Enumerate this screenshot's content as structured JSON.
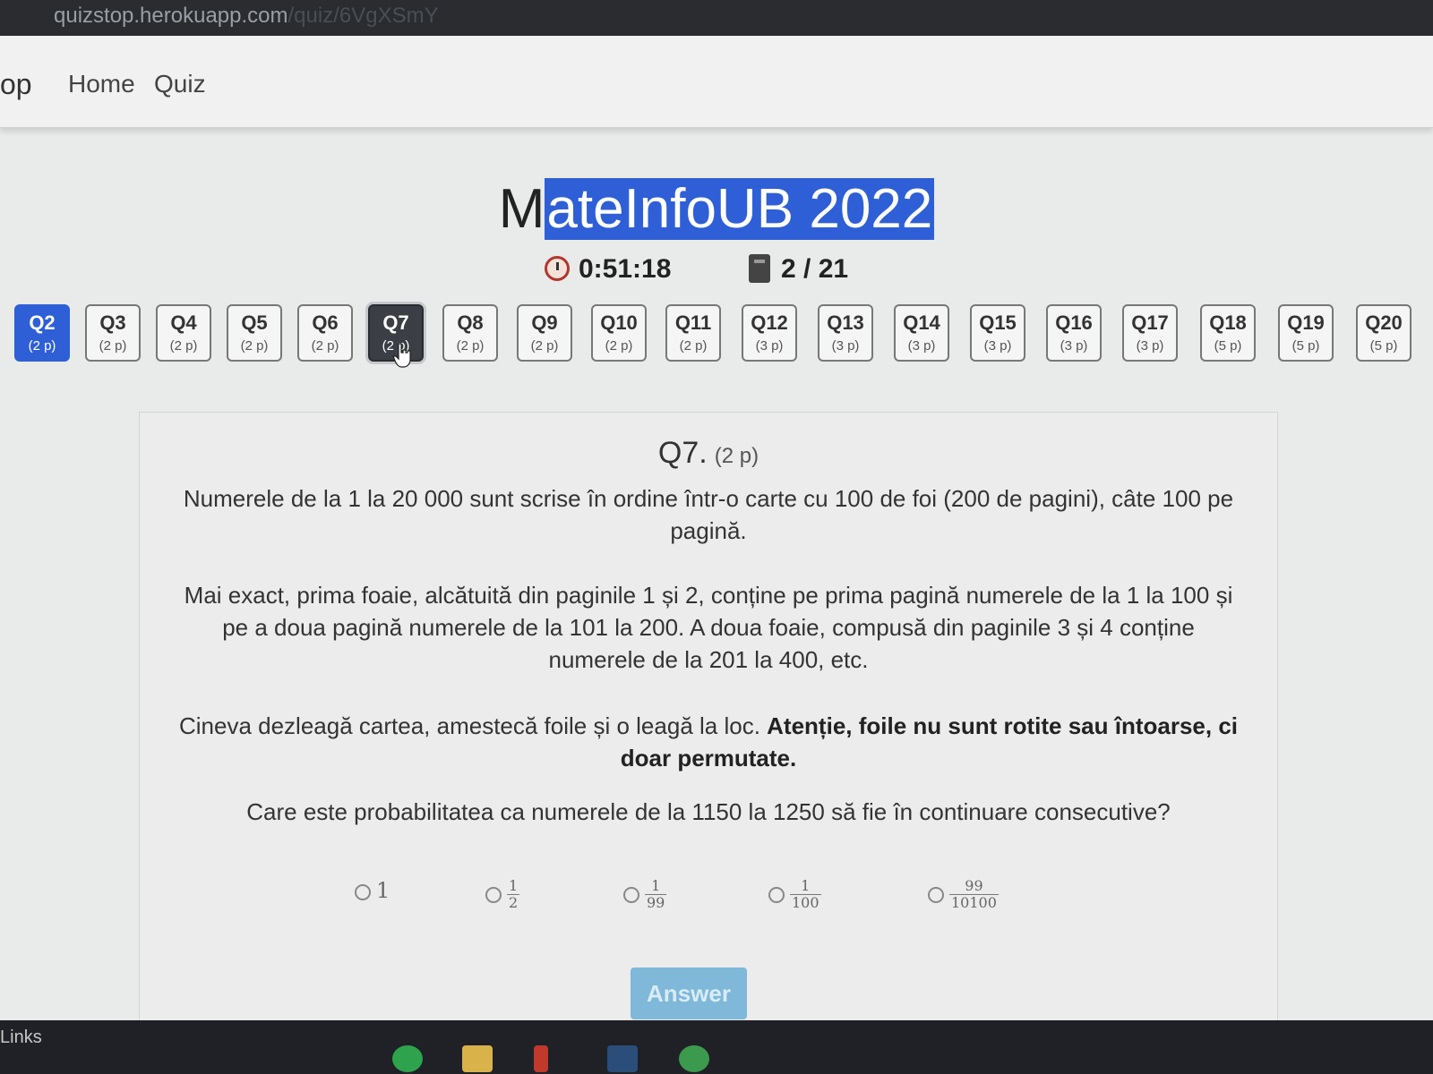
{
  "browser": {
    "url": "quizstop.herokuapp.com",
    "url_dim": "/quiz/6VgXSmY"
  },
  "navbar": {
    "brand": "op",
    "links": [
      "Home",
      "Quiz"
    ]
  },
  "title": {
    "first_letter": "M",
    "rest": "ateInfoUB 2022"
  },
  "stats": {
    "timer": "0:51:18",
    "progress": "2 / 21"
  },
  "questions": [
    {
      "label": "Q2",
      "points": "(2 p)"
    },
    {
      "label": "Q3",
      "points": "(2 p)"
    },
    {
      "label": "Q4",
      "points": "(2 p)"
    },
    {
      "label": "Q5",
      "points": "(2 p)"
    },
    {
      "label": "Q6",
      "points": "(2 p)"
    },
    {
      "label": "Q7",
      "points": "(2 p)"
    },
    {
      "label": "Q8",
      "points": "(2 p)"
    },
    {
      "label": "Q9",
      "points": "(2 p)"
    },
    {
      "label": "Q10",
      "points": "(2 p)"
    },
    {
      "label": "Q11",
      "points": "(2 p)"
    },
    {
      "label": "Q12",
      "points": "(3 p)"
    },
    {
      "label": "Q13",
      "points": "(3 p)"
    },
    {
      "label": "Q14",
      "points": "(3 p)"
    },
    {
      "label": "Q15",
      "points": "(3 p)"
    },
    {
      "label": "Q16",
      "points": "(3 p)"
    },
    {
      "label": "Q17",
      "points": "(3 p)"
    },
    {
      "label": "Q18",
      "points": "(5 p)"
    },
    {
      "label": "Q19",
      "points": "(5 p)"
    },
    {
      "label": "Q20",
      "points": "(5 p)"
    }
  ],
  "question": {
    "name": "Q7.",
    "points": "(2 p)",
    "p1": "Numerele de la 1 la 20 000 sunt scrise în ordine într-o carte cu 100 de foi (200 de pagini), câte 100 pe pagină.",
    "p2": "Mai exact, prima foaie, alcătuită din paginile 1 și 2, conține pe prima pagină numerele de la 1 la 100 și pe a doua pagină numerele de la 101 la 200. A doua foaie, compusă din paginile 3 și 4 conține numerele de la 201 la 400, etc.",
    "p3_normal": "Cineva dezleagă cartea, amestecă foile și o leagă la loc. ",
    "p3_bold": "Atenție, foile nu sunt rotite sau întoarse, ci doar permutate.",
    "p4": "Care este probabilitatea ca numerele de la 1150 la 1250 să fie în continuare consecutive?"
  },
  "options": [
    {
      "whole": "1"
    },
    {
      "num": "1",
      "den": "2"
    },
    {
      "num": "1",
      "den": "99"
    },
    {
      "num": "1",
      "den": "100"
    },
    {
      "num": "99",
      "den": "10100"
    }
  ],
  "answer_label": "Answer",
  "taskbar": {
    "links_label": "Links"
  },
  "colors": {
    "accent": "#2f5fd6",
    "active_button": "#3b3e45",
    "answer_button": "#7fb8d8"
  }
}
